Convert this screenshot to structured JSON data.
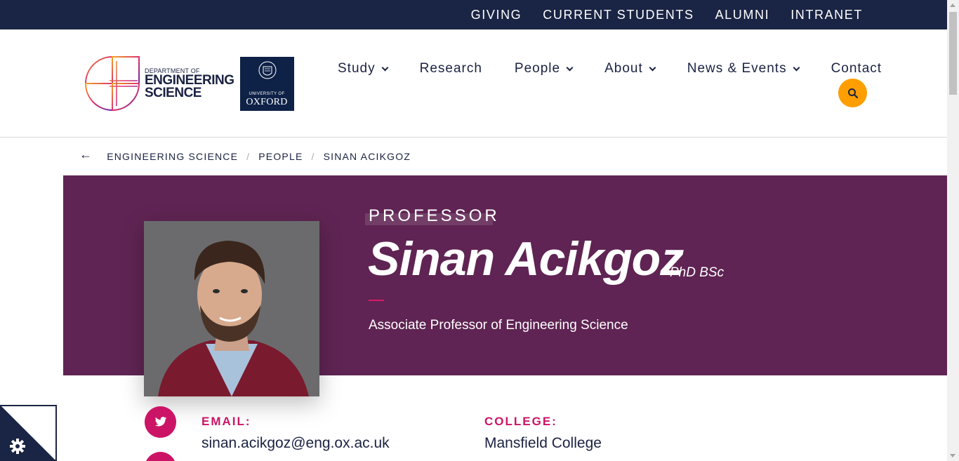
{
  "utility_nav": {
    "links": [
      "GIVING",
      "CURRENT STUDENTS",
      "ALUMNI",
      "INTRANET"
    ]
  },
  "header": {
    "dept_logo": {
      "line1": "DEPARTMENT OF",
      "line2": "ENGINEERING",
      "line3": "SCIENCE"
    },
    "oxford_logo": {
      "small": "UNIVERSITY OF",
      "big": "OXFORD"
    },
    "nav": {
      "items": [
        {
          "label": "Study",
          "has_dropdown": true
        },
        {
          "label": "Research",
          "has_dropdown": false
        },
        {
          "label": "People",
          "has_dropdown": true
        },
        {
          "label": "About",
          "has_dropdown": true
        },
        {
          "label": "News & Events",
          "has_dropdown": true
        },
        {
          "label": "Contact",
          "has_dropdown": false
        }
      ]
    },
    "search_icon": "search-icon"
  },
  "breadcrumb": {
    "back_icon": "arrow-left-icon",
    "items": [
      "ENGINEERING SCIENCE",
      "PEOPLE",
      "SINAN ACIKGOZ"
    ],
    "separator": "/"
  },
  "profile": {
    "rank": "PROFESSOR",
    "name": "Sinan Acikgoz",
    "post_nominals": "PhD BSc",
    "position": "Associate Professor of Engineering Science",
    "email_label": "EMAIL:",
    "email": "sinan.acikgoz@eng.ox.ac.uk",
    "college_label": "COLLEGE:",
    "college": "Mansfield College",
    "social": [
      "twitter-icon",
      "social-icon"
    ]
  },
  "cookie_settings": {
    "icon": "gear-icon"
  },
  "colors": {
    "navy": "#1a2444",
    "hero_purple": "#5f2453",
    "accent_pink": "#cc1466",
    "search_orange": "#ff9e00"
  }
}
